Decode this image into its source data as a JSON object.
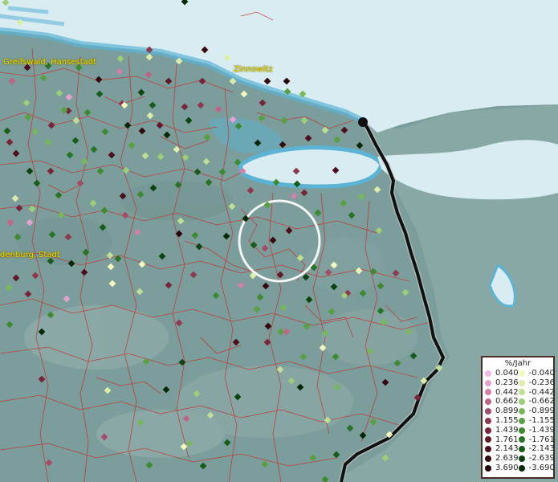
{
  "map": {
    "labels": [
      {
        "text": "Greifswald, Hansestadt"
      },
      {
        "text": "Zinnowitz"
      },
      {
        "text": "denburg, Stadt"
      }
    ]
  },
  "legend": {
    "title": "%/Jahr",
    "positive": [
      {
        "value": "0.040",
        "color": "#f2b8e6"
      },
      {
        "value": "0.236",
        "color": "#e6a0cf"
      },
      {
        "value": "0.442",
        "color": "#d47ea8"
      },
      {
        "value": "0.662",
        "color": "#c06488"
      },
      {
        "value": "0.899",
        "color": "#a84a6a"
      },
      {
        "value": "1.155",
        "color": "#903850"
      },
      {
        "value": "1.439",
        "color": "#78243a"
      },
      {
        "value": "1.761",
        "color": "#621828"
      },
      {
        "value": "2.143",
        "color": "#4c0e1a"
      },
      {
        "value": "2.639",
        "color": "#360810"
      },
      {
        "value": "3.690",
        "color": "#22040a"
      }
    ],
    "negative": [
      {
        "value": "-0.040",
        "color": "#f4f8bc"
      },
      {
        "value": "-0.236",
        "color": "#dcedaa"
      },
      {
        "value": "-0.442",
        "color": "#bfe094"
      },
      {
        "value": "-0.662",
        "color": "#9ccf78"
      },
      {
        "value": "-0.899",
        "color": "#78b85a"
      },
      {
        "value": "-1.155",
        "color": "#58a040"
      },
      {
        "value": "-1.439",
        "color": "#3e8a30"
      },
      {
        "value": "-1.761",
        "color": "#287424"
      },
      {
        "value": "-2.143",
        "color": "#185c18"
      },
      {
        "value": "-2.639",
        "color": "#0c4410"
      },
      {
        "value": "-3.690",
        "color": "#062808"
      }
    ]
  }
}
